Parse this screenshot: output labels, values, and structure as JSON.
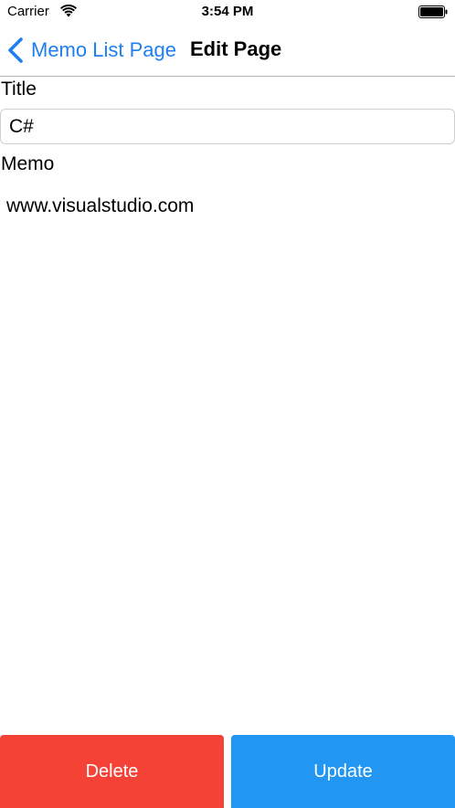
{
  "status_bar": {
    "carrier": "Carrier",
    "time": "3:54 PM",
    "wifi_icon": "wifi-icon",
    "battery_icon": "battery-icon"
  },
  "nav": {
    "back_label": "Memo List Page",
    "back_icon": "chevron-left-icon",
    "title": "Edit Page"
  },
  "form": {
    "title_label": "Title",
    "title_value": "C#",
    "memo_label": "Memo",
    "memo_value": "www.visualstudio.com"
  },
  "actions": {
    "delete_label": "Delete",
    "update_label": "Update"
  },
  "colors": {
    "accent": "#1f7ff0",
    "delete": "#f44336",
    "update": "#2196f3"
  }
}
